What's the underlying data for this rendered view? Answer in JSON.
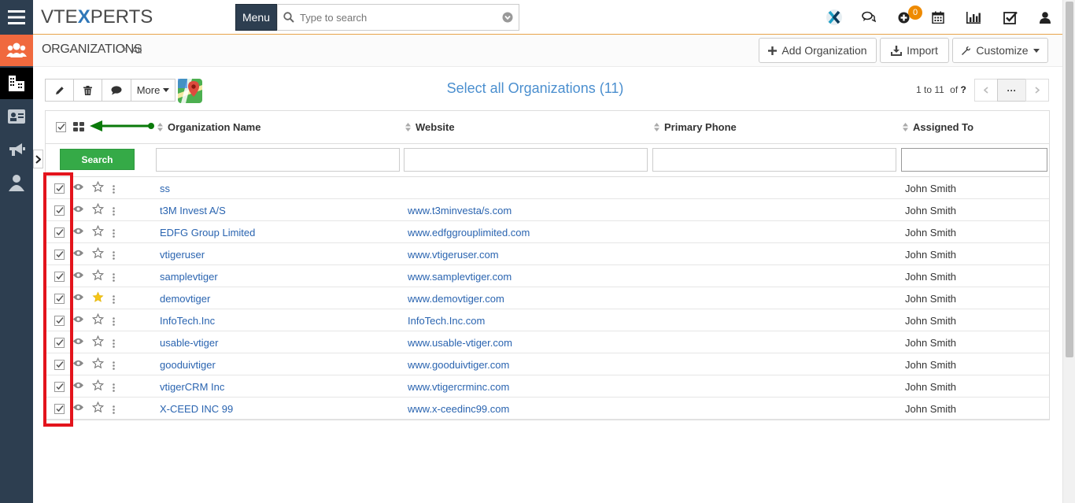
{
  "brand": {
    "logo_left": "VTE",
    "logo_x": "X",
    "logo_right": "PERTS"
  },
  "header": {
    "menu_label": "Menu",
    "search_placeholder": "Type to search",
    "notification_count": "0"
  },
  "breadcrumb": {
    "module": "ORGANIZATIONS",
    "separator": ">",
    "view": "All"
  },
  "header_actions": {
    "add_label": "Add Organization",
    "import_label": "Import",
    "customize_label": "Customize"
  },
  "toolbar": {
    "more_label": "More",
    "select_all_label": "Select all Organizations (11)",
    "pager_text": "1 to 11",
    "pager_of": "of",
    "pager_total": "?",
    "pager_more": "···"
  },
  "table": {
    "columns": [
      "Organization Name",
      "Website",
      "Primary Phone",
      "Assigned To"
    ],
    "search_button": "Search",
    "rows": [
      {
        "name": "ss",
        "website": "",
        "phone": "",
        "assigned": "John Smith",
        "starred": false
      },
      {
        "name": "t3M Invest A/S",
        "website": "www.t3minvesta/s.com",
        "phone": "",
        "assigned": "John Smith",
        "starred": false
      },
      {
        "name": "EDFG Group Limited",
        "website": "www.edfggrouplimited.com",
        "phone": "",
        "assigned": "John Smith",
        "starred": false
      },
      {
        "name": "vtigeruser",
        "website": "www.vtigeruser.com",
        "phone": "",
        "assigned": "John Smith",
        "starred": false
      },
      {
        "name": "samplevtiger",
        "website": "www.samplevtiger.com",
        "phone": "",
        "assigned": "John Smith",
        "starred": false
      },
      {
        "name": "demovtiger",
        "website": "www.demovtiger.com",
        "phone": "",
        "assigned": "John Smith",
        "starred": true
      },
      {
        "name": "InfoTech.Inc",
        "website": "InfoTech.Inc.com",
        "phone": "",
        "assigned": "John Smith",
        "starred": false
      },
      {
        "name": "usable-vtiger",
        "website": "www.usable-vtiger.com",
        "phone": "",
        "assigned": "John Smith",
        "starred": false
      },
      {
        "name": "gooduivtiger",
        "website": "www.gooduivtiger.com",
        "phone": "",
        "assigned": "John Smith",
        "starred": false
      },
      {
        "name": "vtigerCRM Inc",
        "website": "www.vtigercrminc.com",
        "phone": "",
        "assigned": "John Smith",
        "starred": false
      },
      {
        "name": "X-CEED INC 99",
        "website": "www.x-ceedinc99.com",
        "phone": "",
        "assigned": "John Smith",
        "starred": false
      }
    ]
  },
  "colors": {
    "sidebar": "#2d3e50",
    "sidebar_active": "#f0693e",
    "link": "#2a64b0",
    "select_all": "#4b8fcf",
    "search_button": "#35aa47",
    "highlight_box": "#e3141c",
    "arrow": "#0a7a0a",
    "star": "#f5c518"
  }
}
